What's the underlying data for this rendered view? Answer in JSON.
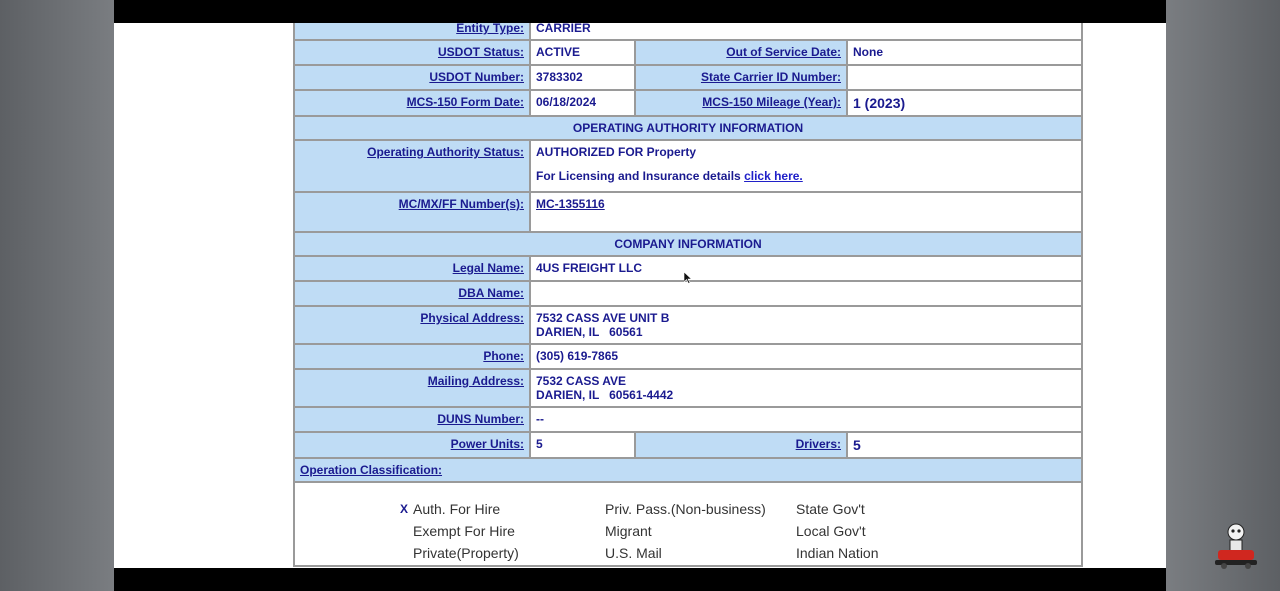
{
  "snapshot": {
    "entity_type_label": "Entity Type:",
    "entity_type": "CARRIER",
    "usdot_status_label": "USDOT Status:",
    "usdot_status": "ACTIVE",
    "out_of_service_label": "Out of Service Date:",
    "out_of_service": "None",
    "usdot_number_label": "USDOT Number:",
    "usdot_number": "3783302",
    "state_carrier_label": "State Carrier ID Number:",
    "state_carrier": "",
    "mcs150_date_label": "MCS-150 Form Date:",
    "mcs150_date": "06/18/2024",
    "mcs150_mileage_label": "MCS-150 Mileage (Year):",
    "mcs150_mileage": "1 (2023)"
  },
  "operating_authority": {
    "header": "OPERATING AUTHORITY INFORMATION",
    "status_label": "Operating Authority Status:",
    "status": "AUTHORIZED FOR Property",
    "licensing_text": "For Licensing and Insurance details",
    "licensing_link": "click here.",
    "mc_label": "MC/MX/FF Number(s):",
    "mc_number": "MC-1355116"
  },
  "company": {
    "header": "COMPANY INFORMATION",
    "legal_name_label": "Legal Name:",
    "legal_name": "4US FREIGHT LLC",
    "dba_label": "DBA Name:",
    "dba": "",
    "physical_label": "Physical Address:",
    "physical_line1": "7532 CASS AVE UNIT B",
    "physical_line2": "DARIEN, IL   60561",
    "phone_label": "Phone:",
    "phone": "(305) 619-7865",
    "mailing_label": "Mailing Address:",
    "mailing_line1": "7532 CASS AVE",
    "mailing_line2": "DARIEN, IL   60561-4442",
    "duns_label": "DUNS Number:",
    "duns": "--",
    "power_units_label": "Power Units:",
    "power_units": "5",
    "drivers_label": "Drivers:",
    "drivers": "5"
  },
  "operation_classification": {
    "label": "Operation Classification:",
    "checked_mark": "X",
    "col1": [
      "Auth. For Hire",
      "Exempt For Hire",
      "Private(Property)"
    ],
    "col2": [
      "Priv. Pass.(Non-business)",
      "Migrant",
      "U.S. Mail"
    ],
    "col3": [
      "State Gov't",
      "Local Gov't",
      "Indian Nation"
    ]
  },
  "overlay": {
    "logo_icon": "channel-logo-icon"
  }
}
